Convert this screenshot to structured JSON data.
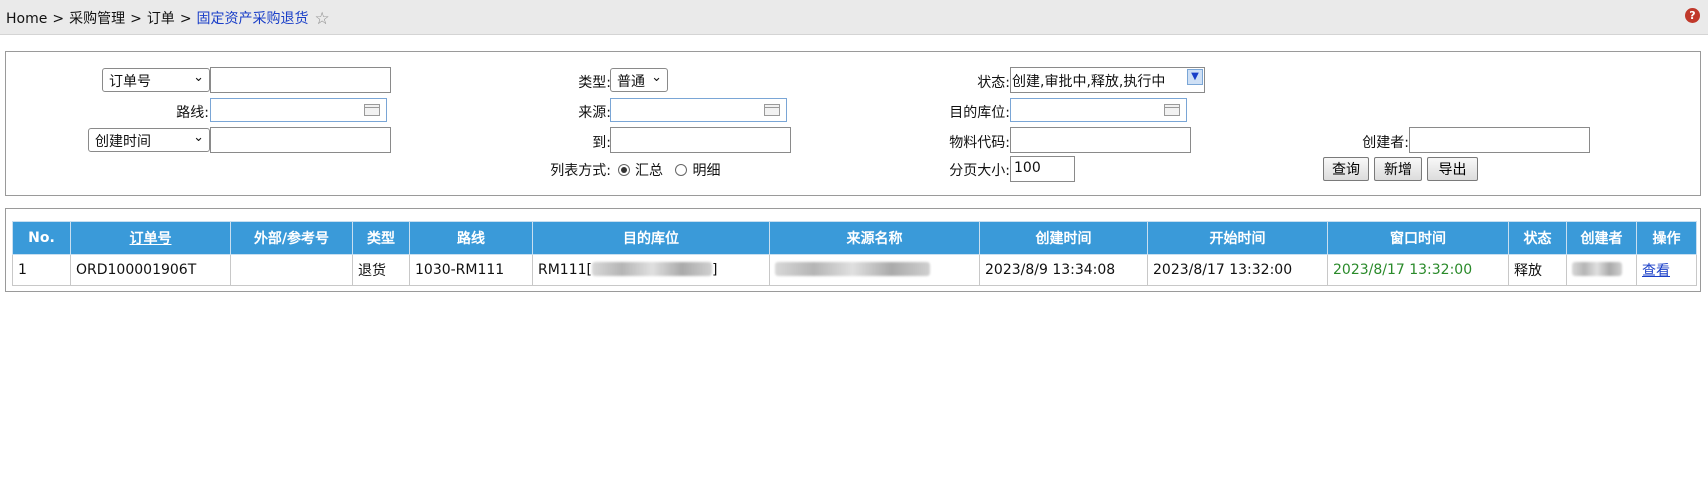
{
  "breadcrumb": {
    "home": "Home",
    "sep": ">",
    "level1": "采购管理",
    "level2": "订单",
    "current": "固定资产采购退货"
  },
  "help_icon": "?",
  "search": {
    "order_field_select": "订单号",
    "route_label": "路线:",
    "time_field_select": "创建时间",
    "type_label": "类型:",
    "type_value": "普通",
    "source_label": "来源:",
    "to_label": "到:",
    "list_mode_label": "列表方式:",
    "list_mode_summary": "汇总",
    "list_mode_detail": "明细",
    "status_label": "状态:",
    "status_value": "创建,审批中,释放,执行中",
    "dest_label": "目的库位:",
    "material_label": "物料代码:",
    "page_size_label": "分页大小:",
    "page_size_value": "100",
    "creator_label": "创建者:",
    "query_button": "查询",
    "add_button": "新增",
    "export_button": "导出"
  },
  "table": {
    "headers": [
      "No.",
      "订单号",
      "外部/参考号",
      "类型",
      "路线",
      "目的库位",
      "来源名称",
      "创建时间",
      "开始时间",
      "窗口时间",
      "状态",
      "创建者",
      "操作"
    ],
    "rows": [
      {
        "no": "1",
        "order_no": "ORD100001906T",
        "external_ref": "",
        "type": "退货",
        "route": "1030-RM111",
        "dest_prefix": "RM111[",
        "dest_suffix": "]",
        "created": "2023/8/9 13:34:08",
        "start": "2023/8/17 13:32:00",
        "window": "2023/8/17 13:32:00",
        "status": "释放",
        "action": "查看"
      }
    ]
  },
  "colors": {
    "header_bg": "#3a9ad9",
    "window_time": "#2a8a2a",
    "link": "#1a3fc8"
  }
}
